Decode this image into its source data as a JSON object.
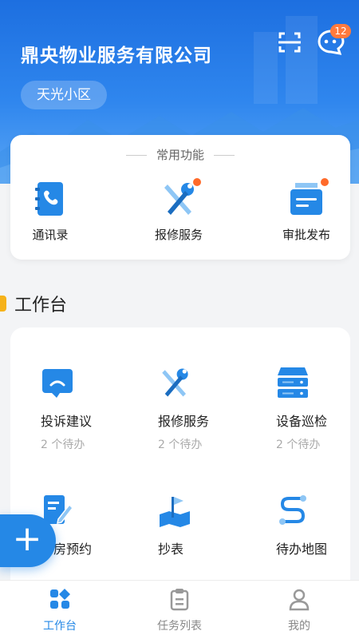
{
  "header": {
    "company": "鼎央物业服务有限公司",
    "community": "天光小区",
    "message_count": "12"
  },
  "common": {
    "title": "常用功能",
    "items": [
      {
        "label": "通讯录",
        "icon": "contacts-icon"
      },
      {
        "label": "报修服务",
        "icon": "repair-tools-icon"
      },
      {
        "label": "审批发布",
        "icon": "approval-inbox-icon"
      }
    ]
  },
  "workbench": {
    "title": "工作台",
    "items": [
      {
        "label": "投诉建议",
        "sub": "2 个待办",
        "icon": "complaint-chat-icon"
      },
      {
        "label": "报修服务",
        "sub": "2 个待办",
        "icon": "repair-tools-icon"
      },
      {
        "label": "设备巡检",
        "sub": "2 个待办",
        "icon": "server-icon"
      },
      {
        "label": "看房预约",
        "icon": "edit-document-icon"
      },
      {
        "label": "抄表",
        "icon": "flag-map-icon"
      },
      {
        "label": "待办地图",
        "icon": "route-icon"
      }
    ]
  },
  "nav": {
    "items": [
      {
        "label": "工作台",
        "icon": "dashboard-icon",
        "active": true
      },
      {
        "label": "任务列表",
        "icon": "clipboard-icon"
      },
      {
        "label": "我的",
        "icon": "user-icon"
      }
    ]
  },
  "colors": {
    "primary": "#2588e6",
    "badge": "#ff7a3d",
    "accent_bar": "#f6b21a"
  }
}
